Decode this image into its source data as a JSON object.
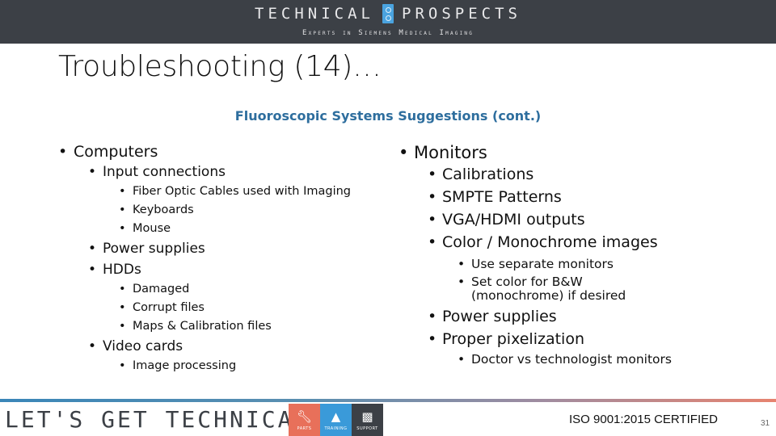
{
  "header": {
    "brand_left": "TECHNICAL",
    "brand_right": "PROSPECTS",
    "logo_icon": "double-circle-logo-icon",
    "tagline": "Experts in Siemens Medical Imaging"
  },
  "slide": {
    "title": "Troubleshooting (14)…",
    "subtitle": "Fluoroscopic Systems Suggestions (cont.)"
  },
  "left_column": {
    "items": [
      {
        "level": 1,
        "text": "Computers"
      },
      {
        "level": 2,
        "text": "Input connections"
      },
      {
        "level": 3,
        "text": "Fiber Optic Cables used with Imaging"
      },
      {
        "level": 3,
        "text": "Keyboards"
      },
      {
        "level": 3,
        "text": "Mouse"
      },
      {
        "level": 2,
        "text": "Power supplies"
      },
      {
        "level": 2,
        "text": "HDDs"
      },
      {
        "level": 3,
        "text": "Damaged"
      },
      {
        "level": 3,
        "text": "Corrupt files"
      },
      {
        "level": 3,
        "text": "Maps & Calibration files"
      },
      {
        "level": 2,
        "text": "Video cards"
      },
      {
        "level": 3,
        "text": "Image processing"
      }
    ]
  },
  "right_column": {
    "items": [
      {
        "level": 1,
        "text": "Monitors"
      },
      {
        "level": 2,
        "text": "Calibrations"
      },
      {
        "level": 2,
        "text": "SMPTE Patterns"
      },
      {
        "level": 2,
        "text": "VGA/HDMI outputs"
      },
      {
        "level": 2,
        "text": "Color / Monochrome images"
      },
      {
        "level": 3,
        "text": "Use separate monitors"
      },
      {
        "level": 3,
        "text": "Set color for B&W (monochrome) if desired"
      },
      {
        "level": 2,
        "text": "Power supplies"
      },
      {
        "level": 2,
        "text": "Proper pixelization"
      },
      {
        "level": 3,
        "text": "Doctor vs technologist monitors"
      }
    ]
  },
  "footer": {
    "slogan": "LET'S GET TECHNICAL",
    "tiles": [
      {
        "label": "PARTS",
        "icon": "wrench-icon",
        "color": "#e8705a"
      },
      {
        "label": "TRAINING",
        "icon": "graduation-cap-icon",
        "color": "#3a9ad9"
      },
      {
        "label": "SUPPORT",
        "icon": "chat-bubbles-icon",
        "color": "#3c4046"
      }
    ],
    "certification": "ISO 9001:2015 CERTIFIED",
    "page_number": "31"
  },
  "colors": {
    "header_bg": "#3c4046",
    "accent_blue": "#2e6e9e",
    "logo_blue": "#4aa3df",
    "accent_orange": "#e8705a"
  }
}
